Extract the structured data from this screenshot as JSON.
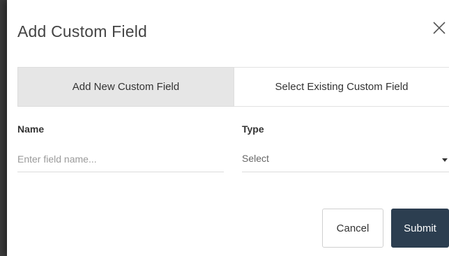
{
  "dialog": {
    "title": "Add Custom Field"
  },
  "tabs": [
    {
      "label": "Add New Custom Field",
      "active": true
    },
    {
      "label": "Select Existing Custom Field",
      "active": false
    }
  ],
  "form": {
    "name": {
      "label": "Name",
      "value": "",
      "placeholder": "Enter field name..."
    },
    "type": {
      "label": "Type",
      "selected": "Select"
    }
  },
  "actions": {
    "cancel_label": "Cancel",
    "submit_label": "Submit"
  },
  "colors": {
    "submit_bg": "#2c3e50",
    "active_tab_bg": "#e6e6e6"
  },
  "icons": {
    "close": "close-icon",
    "dropdown": "chevron-down-icon"
  }
}
